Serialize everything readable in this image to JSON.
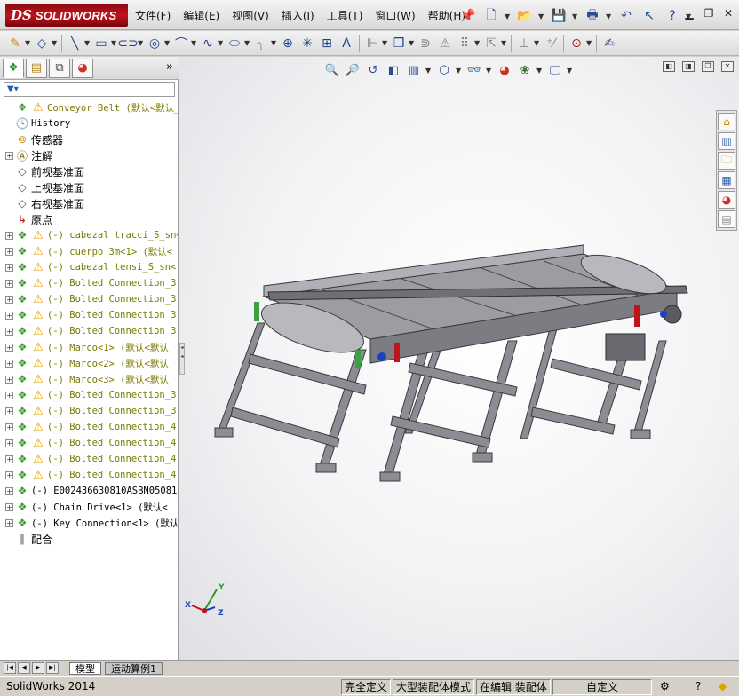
{
  "app": {
    "logo_ds": "DS",
    "logo_text": "SOLIDWORKS"
  },
  "menu": {
    "items": [
      "文件(F)",
      "编辑(E)",
      "视图(V)",
      "插入(I)",
      "工具(T)",
      "窗口(W)",
      "帮助(H)"
    ]
  },
  "panel": {
    "more": "»",
    "tree": [
      {
        "label": "Conveyor Belt  (默认<默认_",
        "icon": "assembly-icon",
        "warn": true,
        "exp": false,
        "olive": true,
        "indent": 0
      },
      {
        "label": "History",
        "icon": "history-icon",
        "warn": false,
        "exp": false,
        "olive": false,
        "indent": 1
      },
      {
        "label": "传感器",
        "icon": "sensor-icon",
        "warn": false,
        "exp": false,
        "olive": false,
        "indent": 1,
        "cn": true
      },
      {
        "label": "注解",
        "icon": "annotation-icon",
        "warn": false,
        "exp": true,
        "olive": false,
        "indent": 1,
        "cn": true
      },
      {
        "label": "前视基准面",
        "icon": "plane-icon",
        "warn": false,
        "exp": false,
        "olive": false,
        "indent": 1,
        "cn": true
      },
      {
        "label": "上视基准面",
        "icon": "plane-icon",
        "warn": false,
        "exp": false,
        "olive": false,
        "indent": 1,
        "cn": true
      },
      {
        "label": "右视基准面",
        "icon": "plane-icon",
        "warn": false,
        "exp": false,
        "olive": false,
        "indent": 1,
        "cn": true
      },
      {
        "label": "原点",
        "icon": "origin-icon",
        "warn": false,
        "exp": false,
        "olive": false,
        "indent": 1,
        "cn": true
      },
      {
        "label": "(-) cabezal tracci_S_sn<",
        "icon": "assembly-icon",
        "warn": true,
        "exp": true,
        "olive": true,
        "indent": 1
      },
      {
        "label": "(-) cuerpo 3m<1> (默认<",
        "icon": "assembly-icon",
        "warn": true,
        "exp": true,
        "olive": true,
        "indent": 1
      },
      {
        "label": "(-) cabezal tensi_S_sn<",
        "icon": "assembly-icon",
        "warn": true,
        "exp": true,
        "olive": true,
        "indent": 1
      },
      {
        "label": "(-) Bolted Connection_3",
        "icon": "assembly-icon",
        "warn": true,
        "exp": true,
        "olive": true,
        "indent": 1
      },
      {
        "label": "(-) Bolted Connection_3",
        "icon": "assembly-icon",
        "warn": true,
        "exp": true,
        "olive": true,
        "indent": 1
      },
      {
        "label": "(-) Bolted Connection_3",
        "icon": "assembly-icon",
        "warn": true,
        "exp": true,
        "olive": true,
        "indent": 1
      },
      {
        "label": "(-) Bolted Connection_3",
        "icon": "assembly-icon",
        "warn": true,
        "exp": true,
        "olive": true,
        "indent": 1
      },
      {
        "label": "(-) Marco<1> (默认<默认",
        "icon": "assembly-icon",
        "warn": true,
        "exp": true,
        "olive": true,
        "indent": 1
      },
      {
        "label": "(-) Marco<2> (默认<默认",
        "icon": "assembly-icon",
        "warn": true,
        "exp": true,
        "olive": true,
        "indent": 1
      },
      {
        "label": "(-) Marco<3> (默认<默认",
        "icon": "assembly-icon",
        "warn": true,
        "exp": true,
        "olive": true,
        "indent": 1
      },
      {
        "label": "(-) Bolted Connection_3",
        "icon": "assembly-icon",
        "warn": true,
        "exp": true,
        "olive": true,
        "indent": 1
      },
      {
        "label": "(-) Bolted Connection_3",
        "icon": "assembly-icon",
        "warn": true,
        "exp": true,
        "olive": true,
        "indent": 1
      },
      {
        "label": "(-) Bolted Connection_4",
        "icon": "assembly-icon",
        "warn": true,
        "exp": true,
        "olive": true,
        "indent": 1
      },
      {
        "label": "(-) Bolted Connection_4",
        "icon": "assembly-icon",
        "warn": true,
        "exp": true,
        "olive": true,
        "indent": 1
      },
      {
        "label": "(-) Bolted Connection_4",
        "icon": "assembly-icon",
        "warn": true,
        "exp": true,
        "olive": true,
        "indent": 1
      },
      {
        "label": "(-) Bolted Connection_4",
        "icon": "assembly-icon",
        "warn": true,
        "exp": true,
        "olive": true,
        "indent": 1
      },
      {
        "label": "(-) E002436630810ASBN05081",
        "icon": "assembly-icon",
        "warn": false,
        "exp": true,
        "olive": false,
        "indent": 1
      },
      {
        "label": "(-) Chain Drive<1> (默认<",
        "icon": "assembly-icon",
        "warn": false,
        "exp": true,
        "olive": false,
        "indent": 1
      },
      {
        "label": "(-) Key Connection<1> (默认",
        "icon": "assembly-icon",
        "warn": false,
        "exp": true,
        "olive": false,
        "indent": 1
      },
      {
        "label": "配合",
        "icon": "mates-icon",
        "warn": false,
        "exp": false,
        "olive": false,
        "indent": 1,
        "cn": true
      }
    ]
  },
  "tabs": {
    "model": "模型",
    "motion": "运动算例1"
  },
  "status": {
    "app_version": "SolidWorks 2014",
    "defined": "完全定义",
    "mode": "大型装配体模式",
    "editing": "在编辑 装配体",
    "units": "自定义",
    "help_icon": "?"
  },
  "triad": {
    "x": "X",
    "y": "Y",
    "z": "Z"
  },
  "colors": {
    "brand_red": "#c0141c",
    "warn_yellow": "#d9a400",
    "tree_olive": "#7b7b00",
    "model_steel": "#8c8d92"
  }
}
